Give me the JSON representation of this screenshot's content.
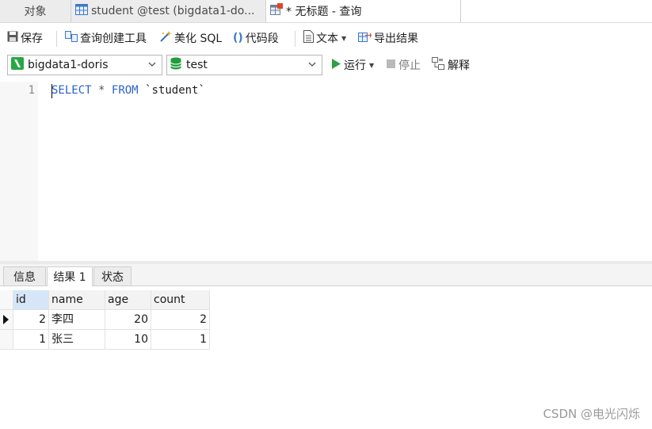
{
  "tabs": [
    {
      "label": "对象",
      "active": false
    },
    {
      "label": "student @test (bigdata1-do...",
      "active": false
    },
    {
      "label": "* 无标题 - 查询",
      "active": true
    }
  ],
  "toolbar": {
    "save": "保存",
    "query_builder": "查询创建工具",
    "beautify": "美化 SQL",
    "snippet": "代码段",
    "text": "文本",
    "export": "导出结果"
  },
  "connection": {
    "connection_name": "bigdata1-doris",
    "database_name": "test",
    "run": "运行",
    "stop": "停止",
    "explain": "解释"
  },
  "editor": {
    "line_number": "1",
    "tokens": {
      "select": "SELECT",
      "star": "*",
      "from": "FROM",
      "table": "`student`"
    }
  },
  "result_tabs": [
    {
      "label": "信息",
      "active": false
    },
    {
      "label": "结果 1",
      "active": true
    },
    {
      "label": "状态",
      "active": false
    }
  ],
  "grid": {
    "columns": [
      "id",
      "name",
      "age",
      "count"
    ],
    "rows": [
      {
        "id": "2",
        "name": "李四",
        "age": "20",
        "count": "2"
      },
      {
        "id": "1",
        "name": "张三",
        "age": "10",
        "count": "1"
      }
    ]
  },
  "watermark": "CSDN @电光闪烁",
  "colors": {
    "keyword": "#2a62c9",
    "run_green": "#2ea043",
    "db_green": "#1f9d3a"
  }
}
